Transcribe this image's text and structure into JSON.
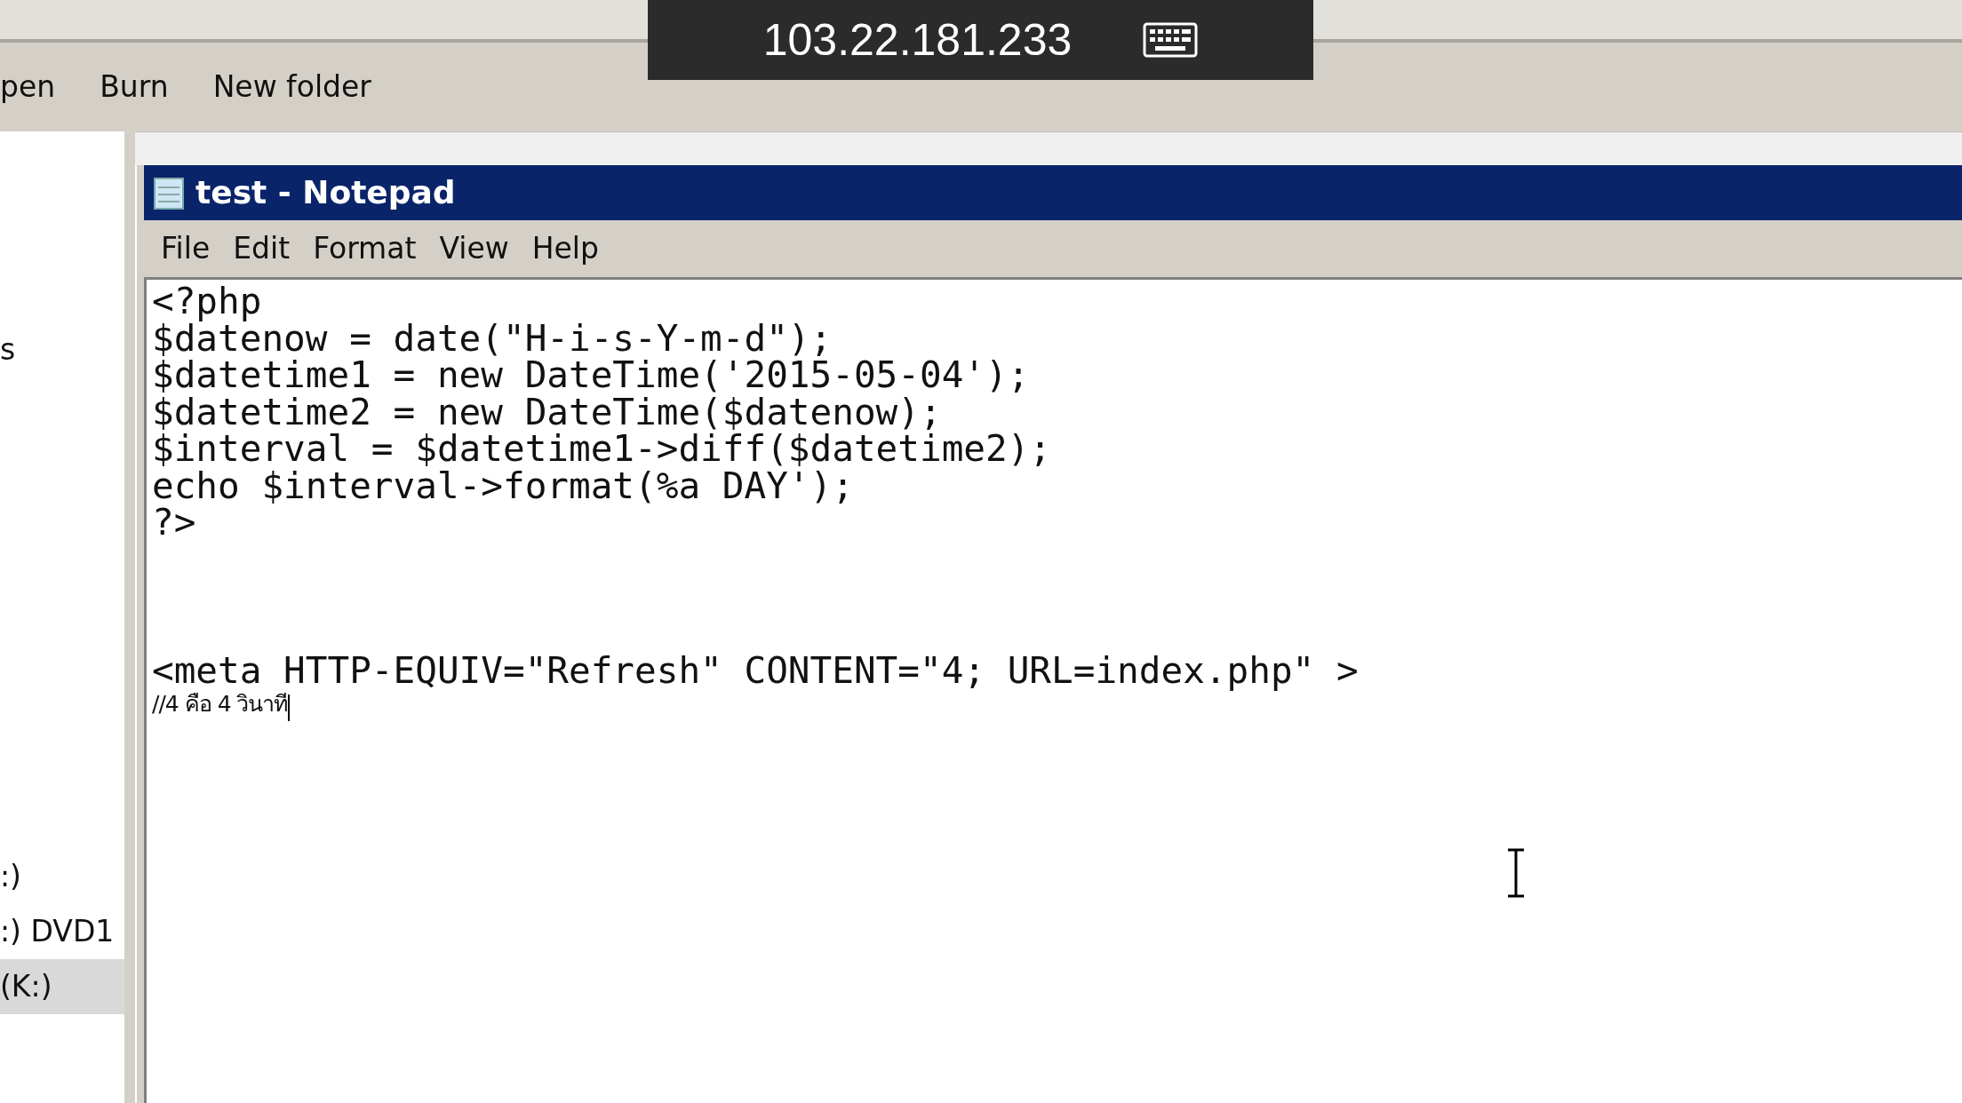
{
  "remote_bar": {
    "address": "103.22.181.233"
  },
  "toolbar": {
    "buttons": [
      "pen",
      "Burn",
      "New folder"
    ]
  },
  "navigation_pane": {
    "items": [
      {
        "label": "s",
        "selected": false
      },
      {
        "label": ":)",
        "selected": false
      },
      {
        "label": ":) DVD1",
        "selected": false
      },
      {
        "label": "(K:)",
        "selected": true
      }
    ]
  },
  "notepad": {
    "title": "test - Notepad",
    "menu": [
      "File",
      "Edit",
      "Format",
      "View",
      "Help"
    ],
    "lines": [
      {
        "kind": "code",
        "text": "<?php"
      },
      {
        "kind": "code",
        "text": "$datenow = date(\"H-i-s-Y-m-d\");"
      },
      {
        "kind": "code",
        "text": "$datetime1 = new DateTime('2015-05-04');"
      },
      {
        "kind": "code",
        "text": "$datetime2 = new DateTime($datenow);"
      },
      {
        "kind": "code",
        "text": "$interval = $datetime1->diff($datetime2);"
      },
      {
        "kind": "code",
        "text": "echo $interval->format(%a DAY');"
      },
      {
        "kind": "code",
        "text": "?>"
      },
      {
        "kind": "gap"
      },
      {
        "kind": "code",
        "text": "<meta HTTP-EQUIV=\"Refresh\" CONTENT=\"4; URL=index.php\" >"
      },
      {
        "kind": "note",
        "text": "//4 คือ 4 วินาที"
      }
    ]
  }
}
